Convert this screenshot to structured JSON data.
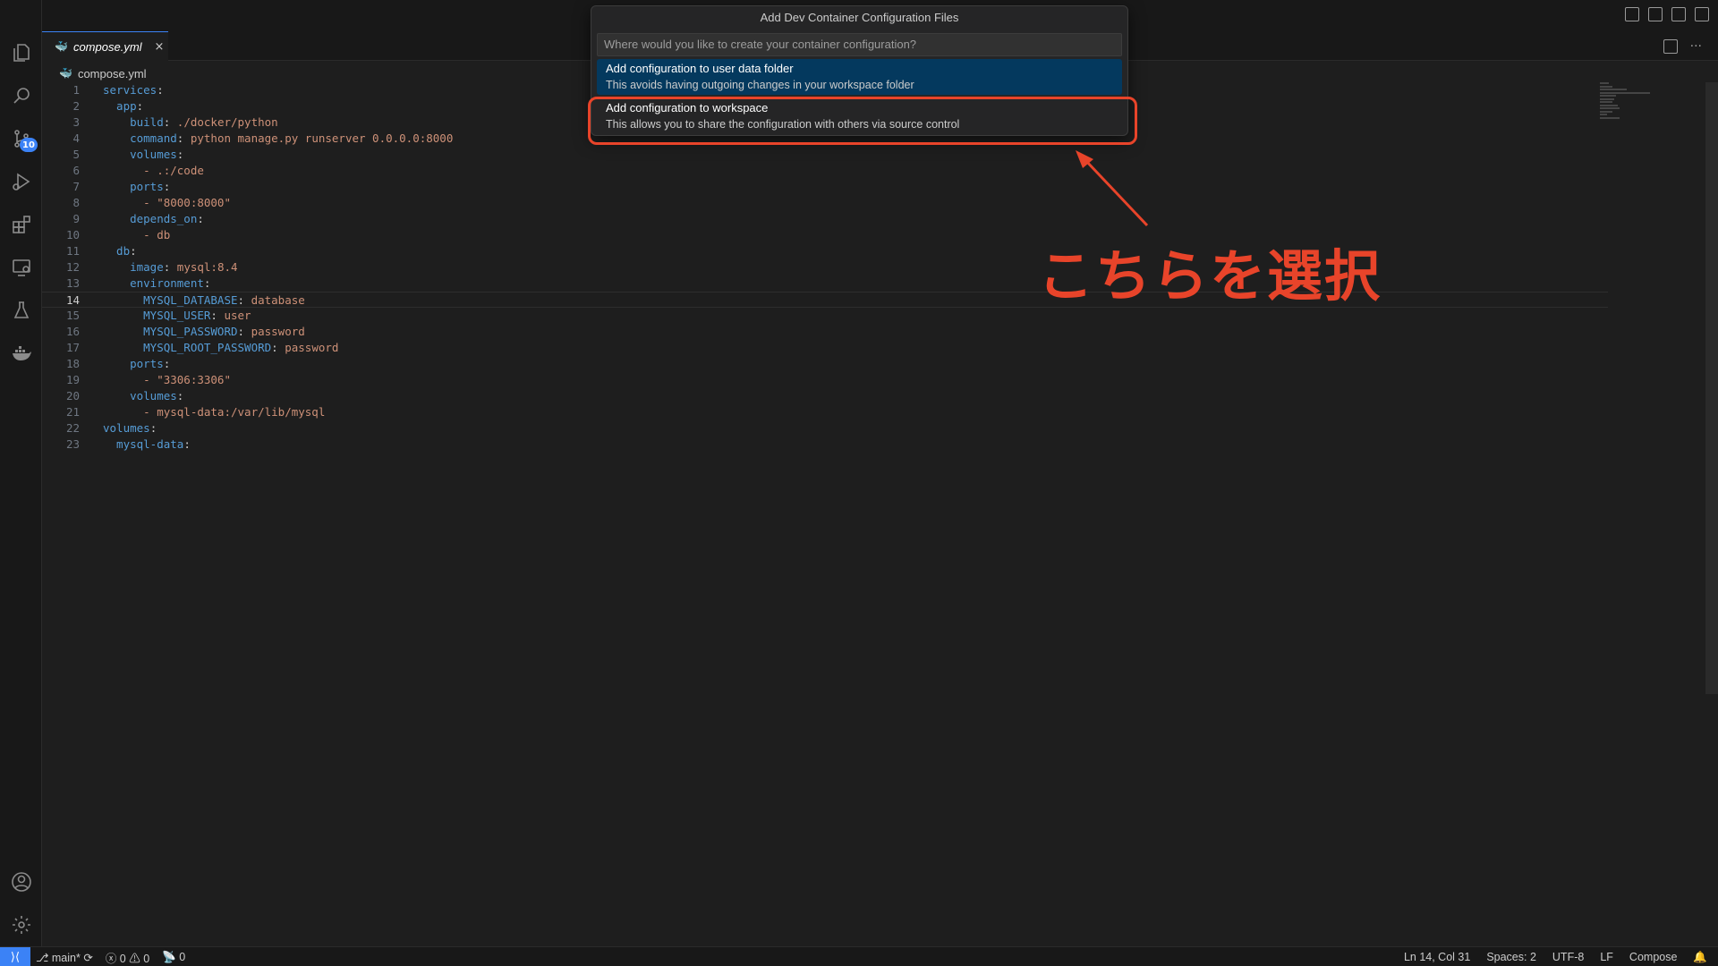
{
  "tab": {
    "filename": "compose.yml",
    "close": "×"
  },
  "breadcrumb": {
    "filename": "compose.yml"
  },
  "activity_bar": {
    "scm_badge": "10"
  },
  "quick_pick": {
    "title": "Add Dev Container Configuration Files",
    "placeholder": "Where would you like to create your container configuration?",
    "items": [
      {
        "label": "Add configuration to user data folder",
        "description": "This avoids having outgoing changes in your workspace folder"
      },
      {
        "label": "Add configuration to workspace",
        "description": "This allows you to share the configuration with others via source control"
      }
    ]
  },
  "annotation": {
    "text": "こちらを選択",
    "color": "#e8442a"
  },
  "editor": {
    "current_line": 14,
    "lines": [
      {
        "n": "1",
        "k": "services",
        "v": ""
      },
      {
        "n": "2",
        "k": "  app",
        "v": ""
      },
      {
        "n": "3",
        "k": "    build",
        "v": " ./docker/python"
      },
      {
        "n": "4",
        "k": "    command",
        "v": " python manage.py runserver 0.0.0.0:8000"
      },
      {
        "n": "5",
        "k": "    volumes",
        "v": ""
      },
      {
        "n": "6",
        "k": "",
        "v": "      - .:/code"
      },
      {
        "n": "7",
        "k": "    ports",
        "v": ""
      },
      {
        "n": "8",
        "k": "",
        "v": "      - \"8000:8000\""
      },
      {
        "n": "9",
        "k": "    depends_on",
        "v": ""
      },
      {
        "n": "10",
        "k": "",
        "v": "      - db"
      },
      {
        "n": "11",
        "k": "  db",
        "v": ""
      },
      {
        "n": "12",
        "k": "    image",
        "v": " mysql:8.4"
      },
      {
        "n": "13",
        "k": "    environment",
        "v": ""
      },
      {
        "n": "14",
        "k": "      MYSQL_DATABASE",
        "v": " database"
      },
      {
        "n": "15",
        "k": "      MYSQL_USER",
        "v": " user"
      },
      {
        "n": "16",
        "k": "      MYSQL_PASSWORD",
        "v": " password"
      },
      {
        "n": "17",
        "k": "      MYSQL_ROOT_PASSWORD",
        "v": " password"
      },
      {
        "n": "18",
        "k": "    ports",
        "v": ""
      },
      {
        "n": "19",
        "k": "",
        "v": "      - \"3306:3306\""
      },
      {
        "n": "20",
        "k": "    volumes",
        "v": ""
      },
      {
        "n": "21",
        "k": "",
        "v": "      - mysql-data:/var/lib/mysql"
      },
      {
        "n": "22",
        "k": "volumes",
        "v": ""
      },
      {
        "n": "23",
        "k": "  mysql-data",
        "v": ""
      }
    ]
  },
  "statusbar": {
    "branch": "main*",
    "errors": "0",
    "warnings": "0",
    "ports": "0",
    "position": "Ln 14, Col 31",
    "spaces": "Spaces: 2",
    "encoding": "UTF-8",
    "eol": "LF",
    "language": "Compose"
  },
  "colors": {
    "accent": "#3b82f6",
    "annotation": "#e8442a",
    "yaml_key": "#569cd6",
    "yaml_value": "#ce9178"
  }
}
